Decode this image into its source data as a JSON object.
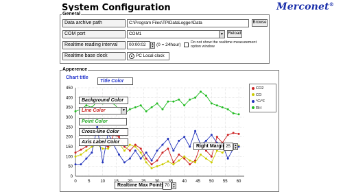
{
  "header": {
    "title": "System Configuration",
    "logo_text": "Merconet",
    "logo_mark": "®"
  },
  "general": {
    "legend": "General",
    "data_archive_path": {
      "label": "Data archive path",
      "value": "C:\\Program Files\\TPIDataLogger\\Data",
      "browse_label": "Browse"
    },
    "com_port": {
      "label": "COM port",
      "value": "COM1",
      "reload_label": "Reload"
    },
    "realtime_reading_interval": {
      "label": "Realtime reading interval",
      "value": "00:00:02",
      "hint": "(0 = 24hour)",
      "checkbox_note": "Do not show the realtime measurement option window"
    },
    "realtime_base_clock": {
      "label": "Realtime base clock",
      "value": "PC Local clock"
    }
  },
  "appearance": {
    "legend": "Apperence",
    "chart_title_label": "Chart title",
    "color_labels": {
      "title": "Title Color",
      "background": "Background Color",
      "line": "Line Color",
      "point": "Point Color",
      "crossline": "Cross-line Color",
      "axis_label": "Axis Label Color"
    },
    "right_margin": {
      "label": "Right Margin",
      "value": "25"
    },
    "max_points": {
      "label": "Realtime Max Points",
      "value": "70"
    }
  },
  "colors": {
    "co2": "#cc2222",
    "co": "#cccc00",
    "tf": "#2233bb",
    "rh": "#22bb22",
    "title_blue": "#2233cc"
  },
  "chart_data": {
    "type": "line",
    "x": [
      0,
      2,
      4,
      6,
      8,
      10,
      12,
      14,
      16,
      18,
      20,
      22,
      24,
      26,
      28,
      30,
      32,
      34,
      36,
      38,
      40,
      42,
      44,
      46,
      48,
      50,
      52,
      54,
      56,
      58,
      60
    ],
    "xticks": [
      "0",
      "5",
      "10",
      "15",
      "20",
      "25",
      "30",
      "35",
      "40",
      "45",
      "50",
      "55",
      "60"
    ],
    "yticks": [
      "0",
      "50",
      "100",
      "150",
      "200",
      "250",
      "300",
      "350",
      "400",
      "450"
    ],
    "ylim": [
      0,
      450
    ],
    "xlim": [
      0,
      62
    ],
    "legend_position": "top-right",
    "series": [
      {
        "name": "CO2",
        "color": "#cc2222",
        "values": [
          120,
          135,
          150,
          170,
          180,
          160,
          150,
          210,
          200,
          150,
          130,
          160,
          140,
          90,
          60,
          80,
          120,
          140,
          70,
          110,
          90,
          60,
          80,
          160,
          130,
          100,
          200,
          170,
          210,
          220,
          215
        ]
      },
      {
        "name": "CO",
        "color": "#cccc00",
        "values": [
          100,
          110,
          130,
          150,
          160,
          140,
          140,
          175,
          165,
          130,
          160,
          150,
          120,
          70,
          40,
          50,
          60,
          75,
          60,
          80,
          100,
          80,
          70,
          110,
          90,
          70,
          130,
          120,
          150,
          160,
          155
        ]
      },
      {
        "name": "°C/°F",
        "color": "#2233bb",
        "values": [
          60,
          60,
          90,
          120,
          250,
          70,
          220,
          160,
          110,
          70,
          90,
          130,
          90,
          120,
          80,
          130,
          160,
          190,
          130,
          180,
          200,
          150,
          230,
          160,
          180,
          210,
          170,
          160,
          90,
          140,
          150
        ]
      },
      {
        "name": "RH",
        "color": "#22bb22",
        "values": [
          330,
          340,
          360,
          350,
          380,
          370,
          390,
          370,
          340,
          320,
          340,
          350,
          360,
          330,
          350,
          370,
          340,
          380,
          380,
          390,
          360,
          390,
          400,
          430,
          410,
          370,
          360,
          350,
          340,
          320,
          315
        ]
      }
    ]
  }
}
